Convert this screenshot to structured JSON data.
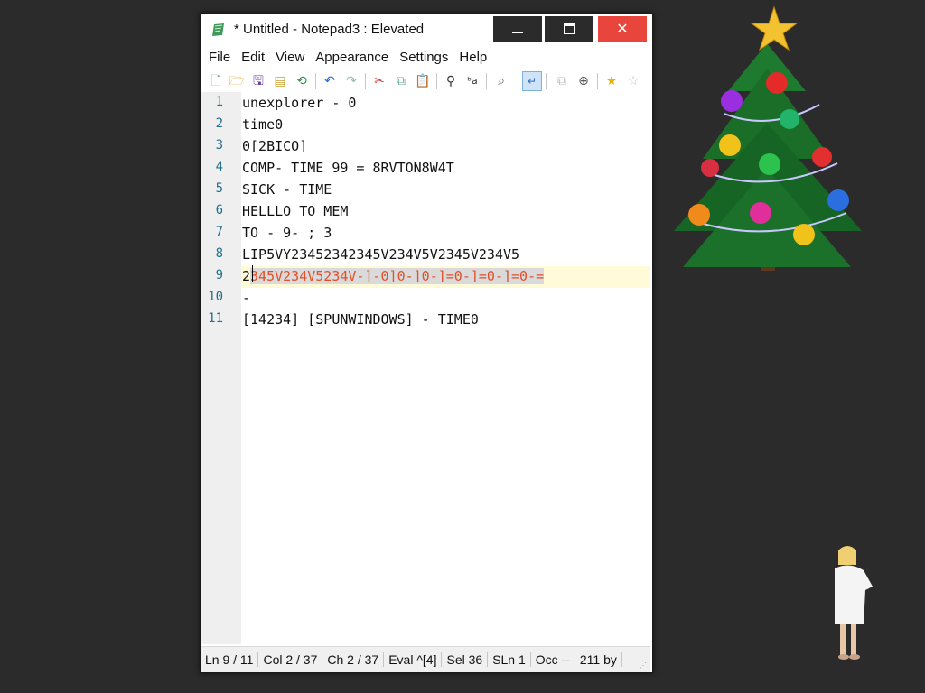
{
  "window": {
    "title": "* Untitled - Notepad3 : Elevated",
    "app_icon": "notepad3-leaf-icon",
    "controls": {
      "minimize": "minimize-icon",
      "maximize": "maximize-icon",
      "close": "✕"
    }
  },
  "menu": [
    "File",
    "Edit",
    "View",
    "Appearance",
    "Settings",
    "Help"
  ],
  "toolbar": [
    "new-file-icon",
    "open-folder-icon",
    "save-icon",
    "save-as-icon",
    "revert-icon",
    "undo-icon",
    "redo-icon",
    "cut-icon",
    "copy-icon",
    "paste-icon",
    "find-icon",
    "replace-icon",
    "zoom-find-icon",
    "word-wrap-icon",
    "copy-all-icon",
    "zoom-icon",
    "favorite-star-icon",
    "add-favorite-icon"
  ],
  "editor": {
    "lines": [
      {
        "n": "1",
        "text": "unexplorer - 0"
      },
      {
        "n": "2",
        "text": "time0"
      },
      {
        "n": "3",
        "text": "0[2BICO]"
      },
      {
        "n": "4",
        "text": "COMP- TIME 99 = 8RVTON8W4T"
      },
      {
        "n": "5",
        "text": "SICK - TIME"
      },
      {
        "n": "6",
        "text": "HELLLO TO MEM"
      },
      {
        "n": "7",
        "text": "TO - 9- ; 3"
      },
      {
        "n": "8",
        "text": "LIP5VY23452342345V234V5V2345V234V5"
      },
      {
        "n": "9",
        "text": "2",
        "selected": "345V234V5234V-]-0]0-]0-]=0-]=0-]=0-="
      },
      {
        "n": "10",
        "text": "-"
      },
      {
        "n": "11",
        "text": "[14234] [SPUNWINDOWS] - TIME0"
      }
    ]
  },
  "status": {
    "ln": "Ln  9 / 11",
    "col": "Col  2 / 37",
    "ch": "Ch  2 / 37",
    "eval": "Eval  ^[4]",
    "sel": "Sel  36",
    "sln": "SLn  1",
    "occ": "Occ  --",
    "bytes": "211 by"
  },
  "colors": {
    "selection_text": "#e0502a",
    "current_line": "#fffbd9",
    "close_button": "#e8453c"
  },
  "decorations": {
    "tree": "christmas-tree-icon",
    "figure": "woman-figure-icon"
  }
}
